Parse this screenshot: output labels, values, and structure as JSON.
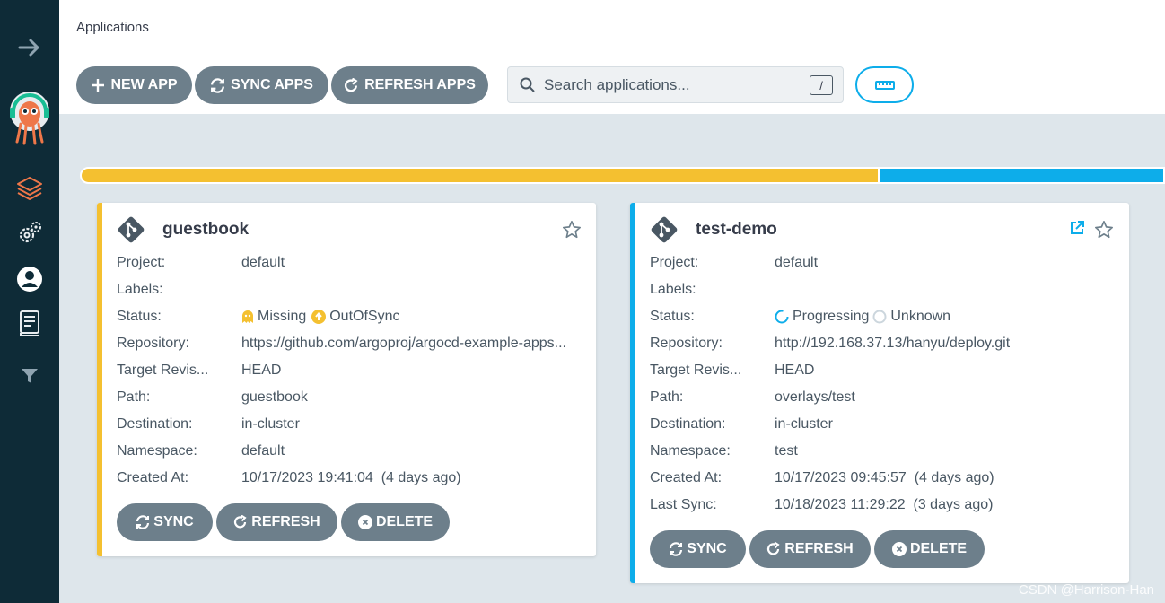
{
  "header": {
    "title": "Applications"
  },
  "toolbar": {
    "new_app": "NEW APP",
    "sync_apps": "SYNC APPS",
    "refresh_apps": "REFRESH APPS",
    "search_placeholder": "Search applications...",
    "search_shortcut": "/"
  },
  "status_bar": {
    "out_of_sync_color": "#f4c030",
    "progressing_color": "#0dadea"
  },
  "labels": {
    "project": "Project:",
    "labels": "Labels:",
    "status": "Status:",
    "repository": "Repository:",
    "target_revision": "Target Revis...",
    "path": "Path:",
    "destination": "Destination:",
    "namespace": "Namespace:",
    "created_at": "Created At:",
    "last_sync": "Last Sync:"
  },
  "apps": [
    {
      "name": "guestbook",
      "project": "default",
      "labels": "",
      "health": "Missing",
      "sync": "OutOfSync",
      "repository": "https://github.com/argoproj/argocd-example-apps...",
      "target_revision": "HEAD",
      "path": "guestbook",
      "destination": "in-cluster",
      "namespace": "default",
      "created_at": "10/17/2023 19:41:04  (4 days ago)",
      "accent": "#f4c030"
    },
    {
      "name": "test-demo",
      "project": "default",
      "labels": "",
      "health": "Progressing",
      "sync": "Unknown",
      "repository": "http://192.168.37.13/hanyu/deploy.git",
      "target_revision": "HEAD",
      "path": "overlays/test",
      "destination": "in-cluster",
      "namespace": "test",
      "created_at": "10/17/2023 09:45:57  (4 days ago)",
      "last_sync": "10/18/2023 11:29:22  (3 days ago)",
      "accent": "#0dadea"
    }
  ],
  "card_actions": {
    "sync": "SYNC",
    "refresh": "REFRESH",
    "delete": "DELETE"
  },
  "watermark": "CSDN @Harrison-Han"
}
